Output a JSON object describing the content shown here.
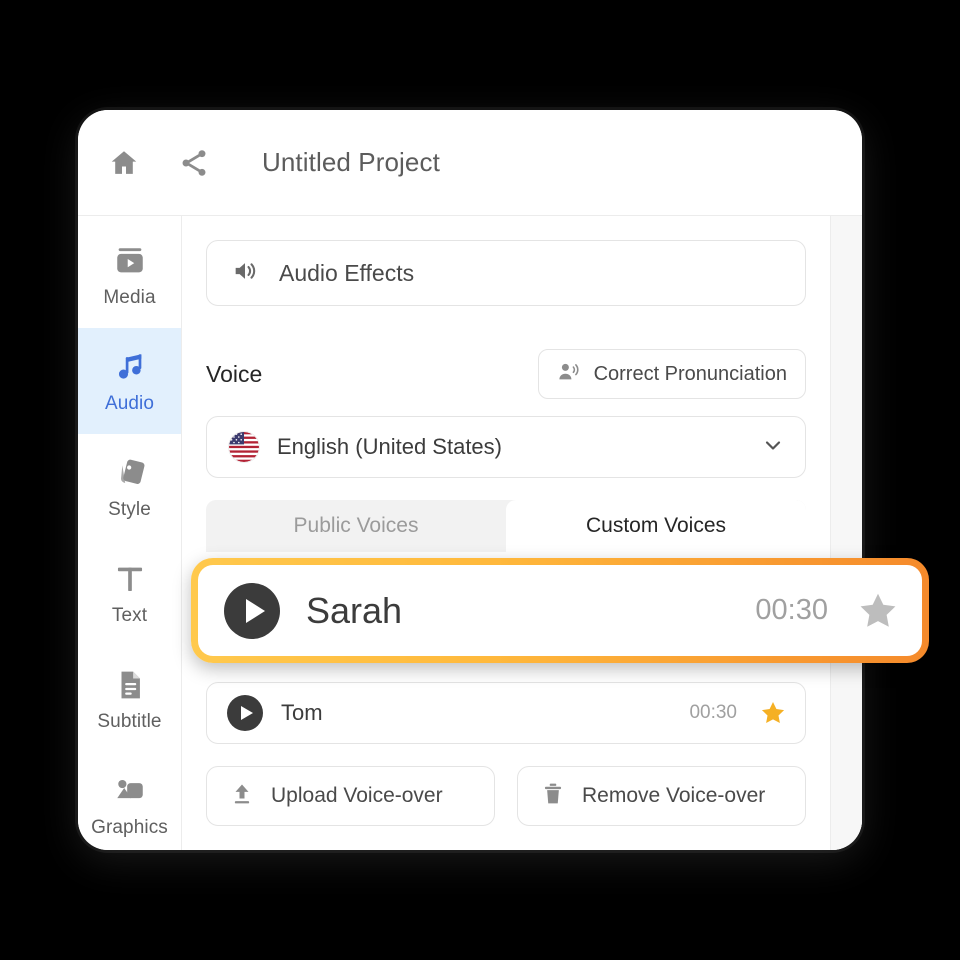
{
  "titlebar": {
    "home_icon": "home-icon",
    "share_icon": "share-icon",
    "project_title": "Untitled Project"
  },
  "sidebar": {
    "items": [
      {
        "label": "Media",
        "icon": "media-icon",
        "active": false
      },
      {
        "label": "Audio",
        "icon": "audio-icon",
        "active": true
      },
      {
        "label": "Style",
        "icon": "style-icon",
        "active": false
      },
      {
        "label": "Text",
        "icon": "text-icon",
        "active": false
      },
      {
        "label": "Subtitle",
        "icon": "subtitle-icon",
        "active": false
      },
      {
        "label": "Graphics",
        "icon": "graphics-icon",
        "active": false
      }
    ]
  },
  "main": {
    "audio_effects": {
      "label": "Audio Effects",
      "icon": "speaker-icon"
    },
    "voice_section": {
      "label": "Voice",
      "correct_pronunciation": {
        "label": "Correct Pronunciation",
        "icon": "person-speaking-icon"
      }
    },
    "language_select": {
      "value": "English (United States)",
      "flag": "us-flag-icon",
      "chevron": "chevron-down-icon"
    },
    "tabs": [
      {
        "label": "Public Voices",
        "active": false
      },
      {
        "label": "Custom Voices",
        "active": true
      }
    ],
    "voices": [
      {
        "name": "Sarah",
        "duration": "00:30",
        "favorite": false,
        "star_color": "#bdbdbd",
        "highlighted": true
      },
      {
        "name": "Tom",
        "duration": "00:30",
        "favorite": true,
        "star_color": "#f5b024",
        "highlighted": false
      }
    ],
    "actions": [
      {
        "label": "Upload Voice-over",
        "icon": "upload-icon"
      },
      {
        "label": "Remove Voice-over",
        "icon": "trash-icon"
      }
    ]
  },
  "colors": {
    "accent_blue": "#3f6fd8",
    "accent_blue_bg": "#e2f0fd",
    "highlight_orange_start": "#ffc94d",
    "highlight_orange_end": "#f58a2b",
    "star_gold": "#f5b024",
    "star_gray": "#bdbdbd",
    "background": "#000000",
    "surface": "#ffffff"
  }
}
